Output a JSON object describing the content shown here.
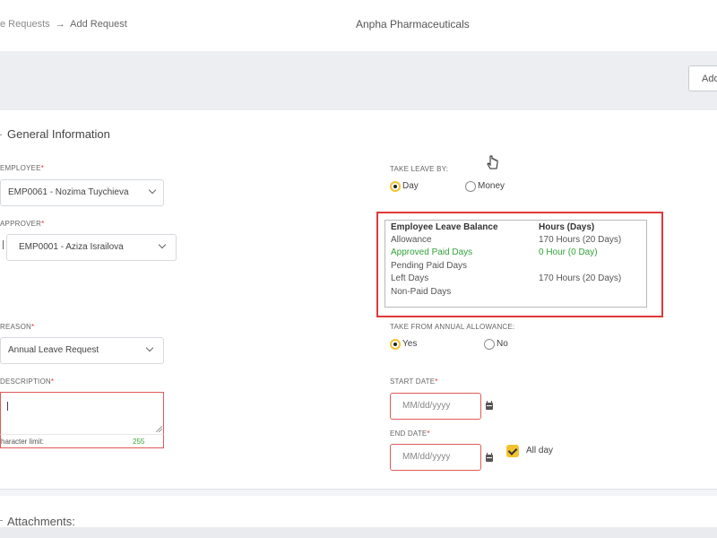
{
  "breadcrumb": {
    "parent": "e Requests",
    "separator": "→",
    "current": "Add Request"
  },
  "company": "Anpha Pharmaceuticals",
  "toolbar": {
    "add_label": "Add"
  },
  "section_general": "General Information",
  "employee": {
    "label": "EMPLOYEE",
    "required": "*",
    "value": "EMP0061 - Nozima Tuychieva"
  },
  "approver": {
    "label": "APPROVER",
    "required": "*",
    "value": "EMP0001 - Aziza Israilova"
  },
  "reason": {
    "label": "REASON",
    "required": "*",
    "value": "Annual Leave Request"
  },
  "description": {
    "label": "DESCRIPTION",
    "required": "*",
    "value": "",
    "char_limit_label": "haracter limit:",
    "char_remaining": "255"
  },
  "take_leave_by": {
    "label": "TAKE LEAVE BY:",
    "options": [
      "Day",
      "Money"
    ],
    "selected": "Day"
  },
  "leave_balance": {
    "header_left": "Employee Leave Balance",
    "header_right": "Hours (Days)",
    "rows": [
      {
        "label": "Allowance",
        "value": "170 Hours (20 Days)"
      },
      {
        "label": "Approved Paid Days",
        "value": "0 Hour (0 Day)"
      },
      {
        "label": "Pending Paid Days",
        "value": ""
      },
      {
        "label": "Left Days",
        "value": "170 Hours (20 Days)"
      },
      {
        "label": "Non-Paid Days",
        "value": ""
      }
    ],
    "highlight_color": "#32a43a",
    "outline_color": "#e0383a"
  },
  "take_from_allowance": {
    "label": "TAKE FROM ANNUAL ALLOWANCE:",
    "options": [
      "Yes",
      "No"
    ],
    "selected": "Yes"
  },
  "start_date": {
    "label": "START DATE",
    "required": "*",
    "placeholder": "MM/dd/yyyy"
  },
  "end_date": {
    "label": "END DATE",
    "required": "*",
    "placeholder": "MM/dd/yyyy"
  },
  "all_day": {
    "label": "All day",
    "checked": true
  },
  "section_attachments": "Attachments:",
  "colors": {
    "accent": "#f2c230",
    "required": "#e0302f",
    "error_border": "#e05a5a"
  }
}
